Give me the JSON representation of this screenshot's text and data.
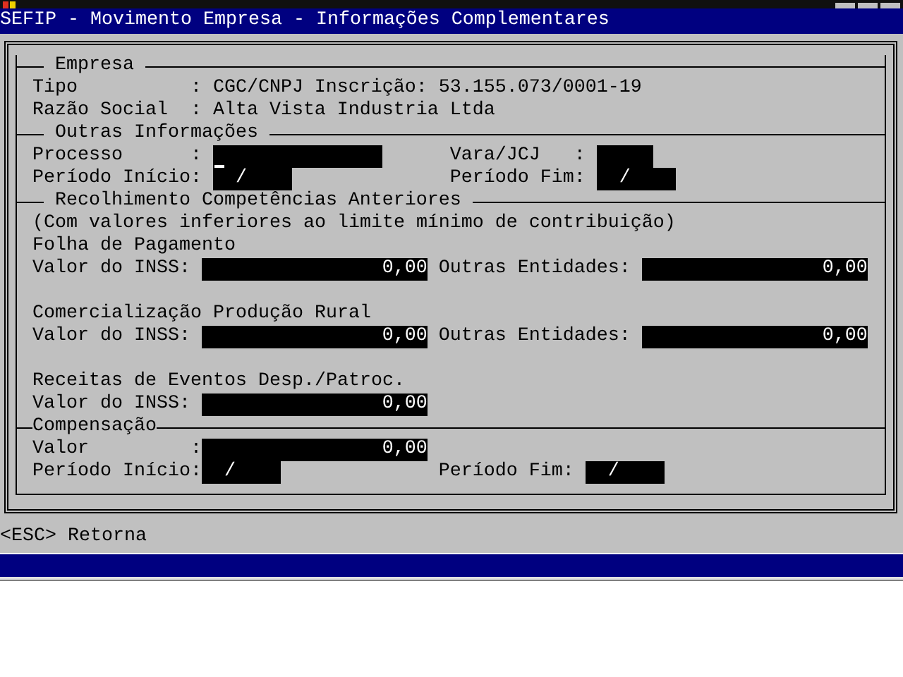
{
  "window": {
    "title": "SEFIP - Movimento Empresa - Informações Complementares"
  },
  "sections": [
    {
      "kind": "info",
      "title": "Empresa",
      "rows": [
        {
          "label": "Tipo",
          "separator": ":",
          "value": "CGC/CNPJ Inscrição: 53.155.073/0001-19"
        },
        {
          "label": "Razão Social",
          "separator": ":",
          "value": "Alta Vista Industria Ltda"
        }
      ]
    },
    {
      "kind": "form",
      "title": "Outras Informações",
      "rows": [
        [
          {
            "label": "Processo",
            "separator": ":",
            "field": {
              "kind": "text",
              "cursor": true
            }
          },
          {
            "label": "Vara/JCJ",
            "separator": ":",
            "field": {
              "kind": "code",
              "cursor": false
            }
          }
        ],
        [
          {
            "label": "Período Início:",
            "field": {
              "kind": "date",
              "value": "/",
              "cursor": false
            }
          },
          {
            "label": "Período Fim:",
            "field": {
              "kind": "date",
              "value": "/",
              "cursor": false
            }
          }
        ]
      ]
    },
    {
      "kind": "amounts",
      "title": "Recolhimento Competências Anteriores",
      "note": "(Com valores inferiores ao limite mínimo de contribuição)",
      "groups": [
        {
          "title": "Folha de Pagamento",
          "rows": [
            [
              {
                "label": "Valor do INSS:",
                "field": {
                  "kind": "money",
                  "value": "0,00",
                  "cursor": false
                }
              },
              {
                "label": "Outras Entidades:",
                "field": {
                  "kind": "money",
                  "value": "0,00",
                  "cursor": false
                }
              }
            ]
          ]
        },
        {
          "title": "Comercialização Produção Rural",
          "rows": [
            [
              {
                "label": "Valor do INSS:",
                "field": {
                  "kind": "money",
                  "value": "0,00",
                  "cursor": false
                }
              },
              {
                "label": "Outras Entidades:",
                "field": {
                  "kind": "money",
                  "value": "0,00",
                  "cursor": false
                }
              }
            ]
          ]
        },
        {
          "title": "Receitas de Eventos Desp./Patroc.",
          "rows": [
            [
              {
                "label": "Valor do INSS:",
                "field": {
                  "kind": "money",
                  "value": "0,00",
                  "cursor": false
                }
              }
            ]
          ]
        }
      ]
    },
    {
      "kind": "compensation",
      "title": "Compensação",
      "rows": [
        [
          {
            "label": "Valor",
            "separator": ":",
            "field": {
              "kind": "money",
              "value": "0,00",
              "cursor": false
            }
          }
        ],
        [
          {
            "label": "Período Início:",
            "field": {
              "kind": "date",
              "value": "/",
              "cursor": false
            }
          },
          {
            "label": "Período Fim:",
            "field": {
              "kind": "date",
              "value": "/",
              "cursor": false
            }
          }
        ]
      ]
    }
  ],
  "footer": {
    "hint": "<ESC> Retorna"
  }
}
